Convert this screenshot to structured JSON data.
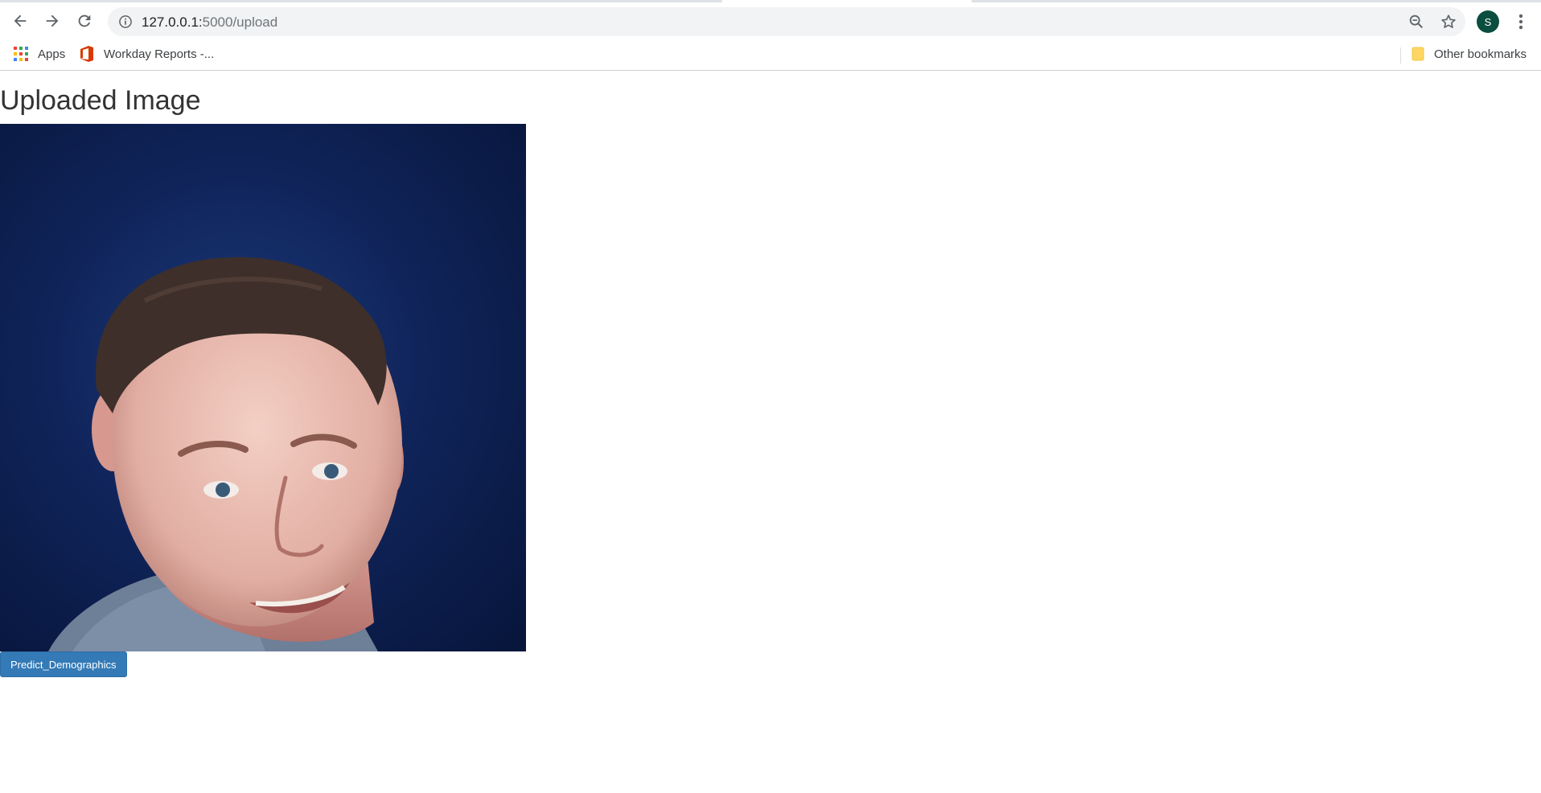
{
  "browser": {
    "url_host": "127.0.0.1:",
    "url_path": "5000/upload",
    "profile_initial": "S",
    "bookmarks": [
      {
        "label": "Apps",
        "icon": "apps-grid-icon"
      },
      {
        "label": "Workday Reports -...",
        "icon": "office-icon"
      }
    ],
    "other_bookmarks": "Other bookmarks",
    "avatar_color": "#0b4d3f"
  },
  "page": {
    "title": "Uploaded Image",
    "image_alt": "uploaded-portrait",
    "predict_button": "Predict_Demographics",
    "button_color": "#337ab7"
  }
}
